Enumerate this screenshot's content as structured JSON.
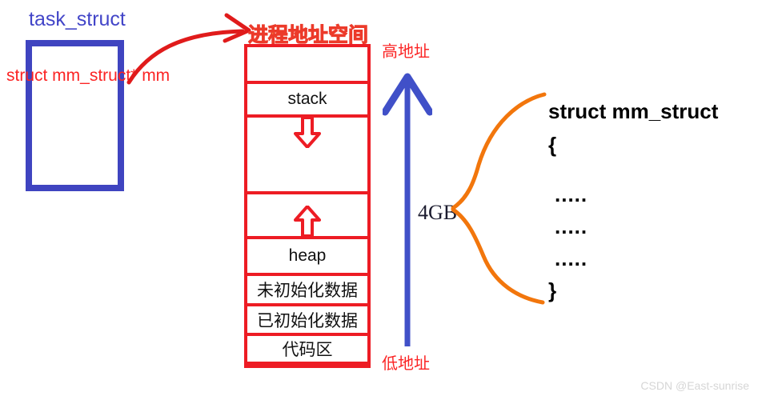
{
  "diagram": {
    "title_left": "task_struct",
    "pointer_field": "struct mm_struct* mm",
    "address_space_title": "进程地址空间",
    "high_address": "高地址",
    "low_address": "低地址",
    "size": "4GB",
    "watermark": "CSDN @East-sunrise"
  },
  "memory_segments": [
    {
      "label": "",
      "name": "kernel-reserved-region"
    },
    {
      "label": "stack",
      "name": "stack-segment"
    },
    {
      "label": "",
      "name": "stack-growth-gap"
    },
    {
      "label": "",
      "name": "heap-growth-gap"
    },
    {
      "label": "heap",
      "name": "heap-segment"
    },
    {
      "label": "未初始化数据",
      "name": "bss-segment"
    },
    {
      "label": "已初始化数据",
      "name": "data-segment"
    },
    {
      "label": "代码区",
      "name": "text-segment"
    },
    {
      "label": "",
      "name": "bottom-region"
    }
  ],
  "mm_struct_code": {
    "title": "struct  mm_struct",
    "open_brace": "{",
    "dots_1": ".....",
    "dots_2": ".....",
    "dots_3": ".....",
    "close_brace": "}"
  },
  "colors": {
    "task_struct_blue": "#3f44c0",
    "memory_red": "#ed1c24",
    "label_red": "#fb2424",
    "title_orange": "#f79646",
    "brace_orange": "#f2760c",
    "arrow_blue": "#4050c8"
  }
}
